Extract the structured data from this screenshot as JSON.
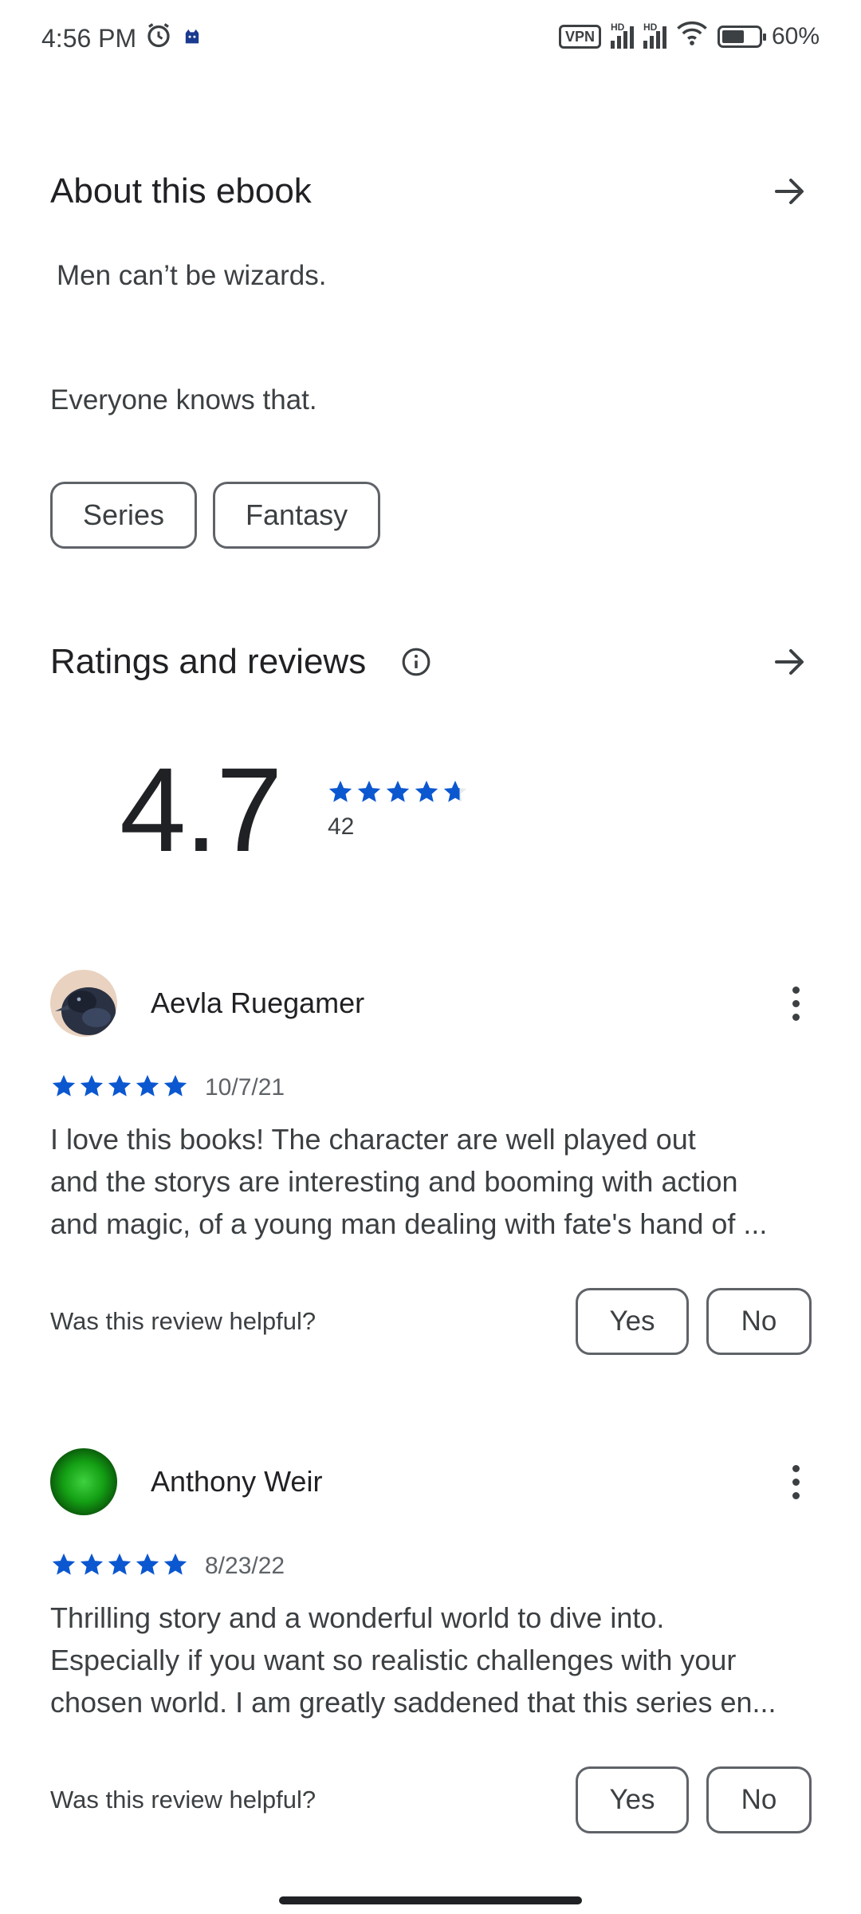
{
  "status_bar": {
    "time": "4:56 PM",
    "battery": "60%",
    "vpn": "VPN",
    "hd": "HD",
    "icons": [
      "alarm-icon",
      "notification-app-icon",
      "vpn-icon",
      "signal-icon",
      "wifi-icon",
      "battery-icon"
    ]
  },
  "about": {
    "title": "About this ebook",
    "paragraph1": "Men can’t be wizards.",
    "paragraph2": "Everyone knows that.",
    "chips": [
      "Series",
      "Fantasy"
    ]
  },
  "ratings": {
    "title": "Ratings and reviews",
    "score": "4.7",
    "stars_value": 4.7,
    "count": "42"
  },
  "reviews": [
    {
      "name": "Aevla Ruegamer",
      "date": "10/7/21",
      "stars_value": 5,
      "lines": [
        "I love this books! The character are well played out",
        "and the storys are interesting and booming with action",
        "and magic, of a young man dealing with fate's hand of ..."
      ],
      "helpful_label": "Was this review helpful?",
      "yes": "Yes",
      "no": "No"
    },
    {
      "name": "Anthony Weir",
      "date": "8/23/22",
      "stars_value": 5,
      "lines": [
        "Thrilling story and a wonderful world to dive into.",
        "Especially if you want so realistic challenges with your",
        "chosen world. I am greatly saddened that this series en..."
      ],
      "helpful_label": "Was this review helpful?",
      "yes": "Yes",
      "no": "No"
    }
  ],
  "colors": {
    "star": "#0b57d0",
    "text_primary": "#202124",
    "text_secondary": "#3c4043",
    "outline": "#5f6368"
  }
}
